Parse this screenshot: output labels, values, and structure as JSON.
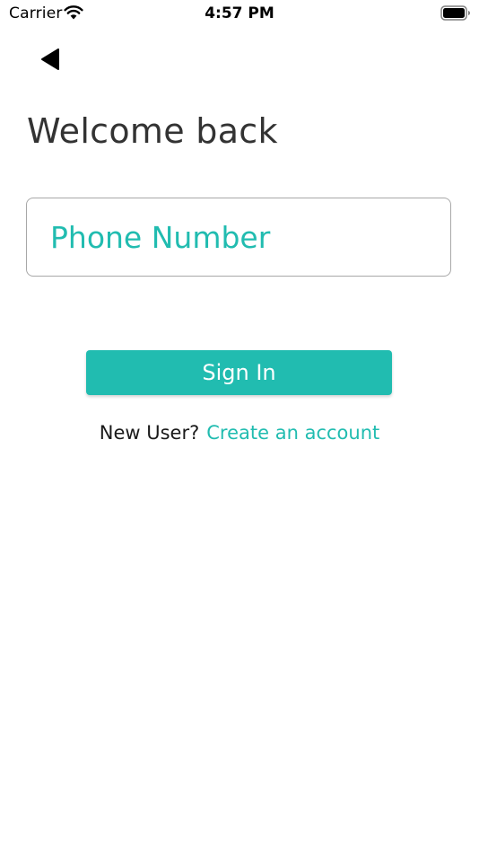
{
  "status_bar": {
    "carrier": "Carrier",
    "time": "4:57 PM",
    "wifi_icon": "wifi-icon",
    "battery_icon": "battery-icon"
  },
  "navigation": {
    "back_icon": "back-arrow-icon"
  },
  "page": {
    "title": "Welcome back"
  },
  "form": {
    "phone": {
      "placeholder": "Phone Number",
      "value": ""
    },
    "signin_label": "Sign In"
  },
  "signup": {
    "prompt": "New User?",
    "link_label": "Create an account"
  },
  "colors": {
    "accent": "#21bcb0",
    "text": "#333333",
    "border": "#a8a8a8",
    "background": "#ffffff"
  }
}
